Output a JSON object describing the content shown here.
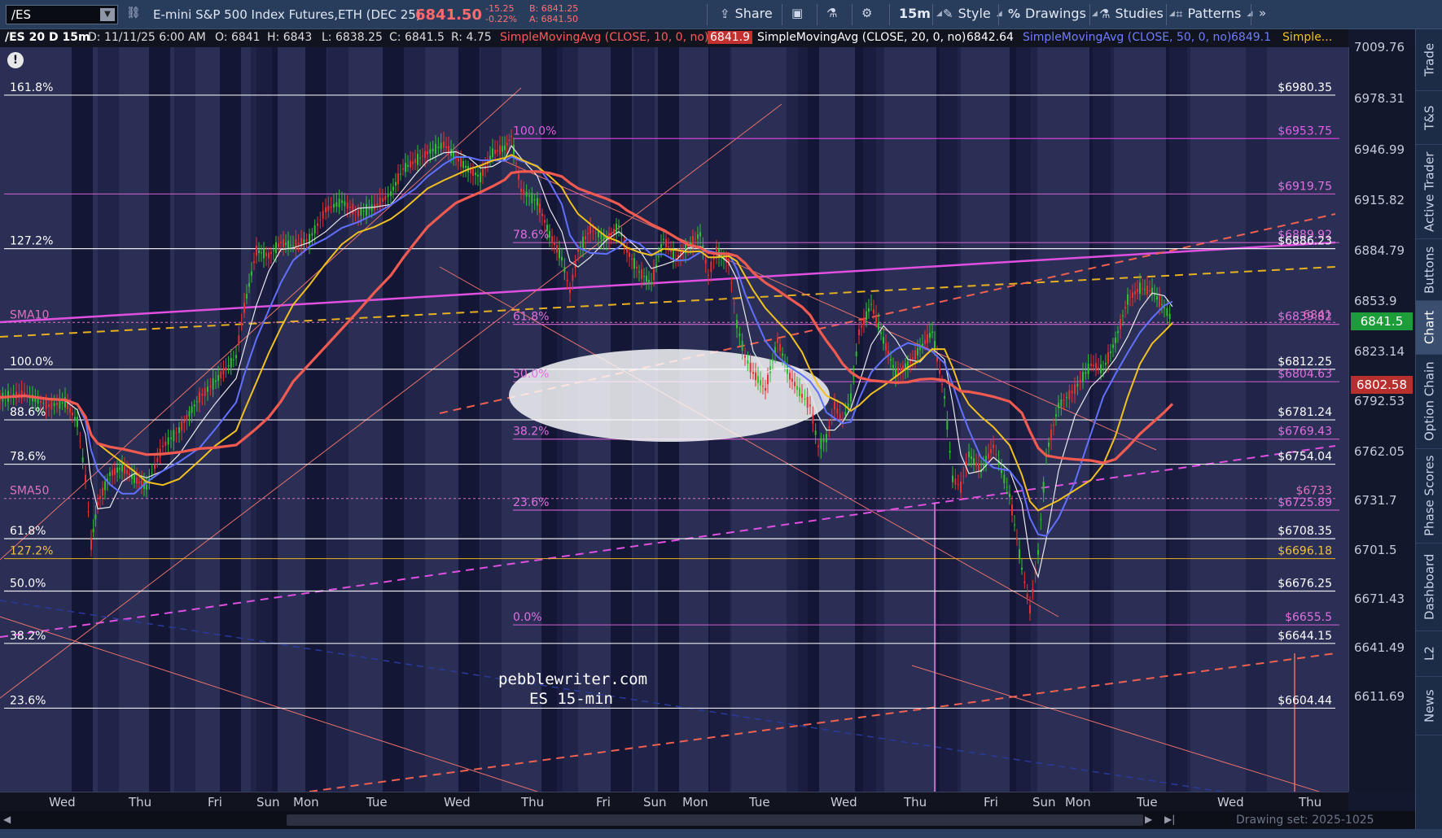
{
  "toolbar": {
    "symbol": "/ES",
    "description": "E-mini S&P 500 Index Futures,ETH (DEC 25)",
    "last_price": "6841.50",
    "net_change": "-15.25",
    "pct_change": "-0.22%",
    "bid": "B: 6841.25",
    "ask": "A: 6841.50",
    "share_label": "Share",
    "timeframe_label": "15m",
    "style_label": "Style",
    "drawings_label": "Drawings",
    "studies_label": "Studies",
    "patterns_label": "Patterns",
    "icons": [
      "link-icon",
      "share-icon",
      "camera-icon",
      "flask-icon",
      "gear-icon",
      "style-icon",
      "percent-icon",
      "studies-icon",
      "patterns-icon",
      "collapse-icon"
    ]
  },
  "info": {
    "period": "/ES 20 D 15m",
    "date": "D: 11/11/25 6:00 AM",
    "open": "O: 6841",
    "high": "H: 6843",
    "low": "L: 6838.25",
    "close": "C: 6841.5",
    "range": "R: 4.75",
    "sma10_label": "SimpleMovingAvg (CLOSE, 10, 0, no)",
    "sma10_value": "6841.9",
    "sma20_label": "SimpleMovingAvg (CLOSE, 20, 0, no)",
    "sma20_value": "6842.64",
    "sma50_label": "SimpleMovingAvg (CLOSE, 50, 0, no)",
    "sma50_value": "6849.1",
    "more_label": "Simple..."
  },
  "chart_data": {
    "type": "candlestick",
    "symbol": "/ES",
    "interval": "15m",
    "price_range": [
      6598,
      7020
    ],
    "price_ticks": [
      7009.76,
      6978.31,
      6946.99,
      6915.82,
      6884.79,
      6853.9,
      6823.14,
      6792.53,
      6762.05,
      6731.7,
      6701.5,
      6671.43,
      6641.49,
      6611.69
    ],
    "time_labels": [
      "Wed",
      "Thu",
      "Fri",
      "Sun",
      "Mon",
      "Tue",
      "Wed",
      "Thu",
      "Fri",
      "Sun",
      "Mon",
      "Tue",
      "Wed",
      "Thu",
      "Fri",
      "Sun",
      "Mon",
      "Tue",
      "Wed",
      "Thu"
    ],
    "price_tags": [
      {
        "value": "6841.5",
        "price": 6841.5,
        "color": "#1d9d3a"
      },
      {
        "value": "6802.58",
        "price": 6802.58,
        "color": "#b8302e"
      }
    ],
    "horizontal_levels": [
      {
        "price": 6980.35,
        "left_label": "161.8%",
        "right_label": "$6980.35",
        "color": "#ffffff",
        "label_color": "#ffffff"
      },
      {
        "price": 6953.75,
        "left_label": "100.0%",
        "right_label": "$6953.75",
        "color": "#e040e0",
        "label_color": "#e45ce4",
        "left_at": "mid"
      },
      {
        "price": 6919.75,
        "left_label": "",
        "right_label": "$6919.75",
        "color": "#d060d0",
        "label_color": "#e070e0"
      },
      {
        "price": 6889.92,
        "left_label": "78.6%",
        "right_label": "$6889.92",
        "color": "#d060d0",
        "label_color": "#e070e0",
        "left_at": "mid"
      },
      {
        "price": 6886.23,
        "left_label": "127.2%",
        "right_label": "$6886.23",
        "color": "#ffffff",
        "label_color": "#ffffff"
      },
      {
        "price": 6839.82,
        "left_label": "61.8%",
        "right_label": "$6839.82",
        "color": "#d060d0",
        "label_color": "#e070e0",
        "left_at": "mid"
      },
      {
        "price": 6812.25,
        "left_label": "100.0%",
        "right_label": "$6812.25",
        "color": "#ffffff",
        "label_color": "#ffffff"
      },
      {
        "price": 6804.63,
        "left_label": "50.0%",
        "right_label": "$6804.63",
        "color": "#d060d0",
        "label_color": "#e070e0",
        "left_at": "mid"
      },
      {
        "price": 6781.24,
        "left_label": "88.6%",
        "right_label": "$6781.24",
        "color": "#ffffff",
        "label_color": "#ffffff"
      },
      {
        "price": 6769.43,
        "left_label": "38.2%",
        "right_label": "$6769.43",
        "color": "#d060d0",
        "label_color": "#e070e0",
        "left_at": "mid"
      },
      {
        "price": 6754.04,
        "left_label": "78.6%",
        "right_label": "$6754.04",
        "color": "#ffffff",
        "label_color": "#ffffff"
      },
      {
        "price": 6725.89,
        "left_label": "23.6%",
        "right_label": "$6725.89",
        "color": "#d060d0",
        "label_color": "#e070e0",
        "left_at": "mid"
      },
      {
        "price": 6708.35,
        "left_label": "61.8%",
        "right_label": "$6708.35",
        "color": "#ffffff",
        "label_color": "#ffffff"
      },
      {
        "price": 6696.18,
        "left_label": "127.2%",
        "right_label": "$6696.18",
        "color": "#e6b020",
        "label_color": "#f0c040"
      },
      {
        "price": 6676.25,
        "left_label": "50.0%",
        "right_label": "$6676.25",
        "color": "#ffffff",
        "label_color": "#ffffff"
      },
      {
        "price": 6655.5,
        "left_label": "0.0%",
        "right_label": "$6655.5",
        "color": "#d060d0",
        "label_color": "#e070e0",
        "left_at": "mid"
      },
      {
        "price": 6644.15,
        "left_label": "38.2%",
        "right_label": "$6644.15",
        "color": "#ffffff",
        "label_color": "#ffffff"
      },
      {
        "price": 6604.44,
        "left_label": "23.6%",
        "right_label": "$6604.44",
        "color": "#ffffff",
        "label_color": "#ffffff"
      }
    ],
    "sma_markers": [
      {
        "label": "SMA10",
        "price": 6841,
        "right_label": "6841"
      },
      {
        "label": "SMA50",
        "price": 6733,
        "right_label": "$6733"
      }
    ],
    "watermark": [
      "pebblewriter.com",
      "ES 15-min"
    ],
    "series": [
      {
        "name": "SMA10",
        "color": "#e8e8e8"
      },
      {
        "name": "SMA20",
        "color": "#5566ff"
      },
      {
        "name": "SMA50",
        "color": "#f0c020"
      },
      {
        "name": "SMA200",
        "color": "#f05a50"
      }
    ]
  },
  "axis": {
    "drawing_set": "Drawing set: 2025-1025"
  },
  "sidebar": {
    "tabs": [
      "Trade",
      "T&S",
      "Active Trader",
      "Buttons",
      "Chart",
      "Option Chain",
      "Phase Scores",
      "Dashboard",
      "L2",
      "News"
    ],
    "active": "Chart"
  }
}
